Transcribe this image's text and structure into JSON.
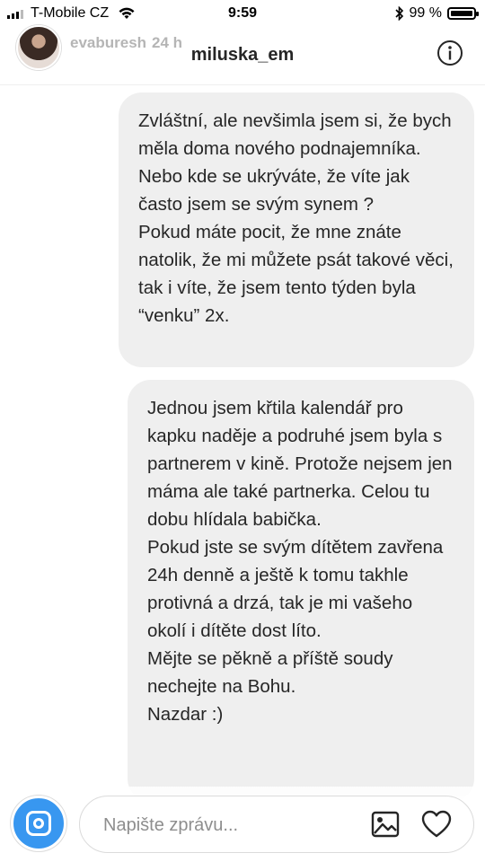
{
  "status_bar": {
    "carrier": "T-Mobile CZ",
    "time": "9:59",
    "battery_percent": "99 %",
    "battery_level": 0.99
  },
  "header": {
    "story_username": "evaburesh",
    "story_age": "24 h",
    "thread_title": "miluska_em",
    "info_icon": "info-icon"
  },
  "messages": [
    {
      "paragraphs": [
        "Zvláštní, ale nevšimla jsem si, že bych měla doma nového podnajemníka. Nebo kde se ukrýváte, že víte jak často jsem se svým synem ?",
        "Pokud máte pocit, že mne znáte natolik, že mi můžete psát takové věci, tak i víte, že jsem tento týden byla “venku” 2x."
      ]
    },
    {
      "paragraphs": [
        "Jednou jsem křtila kalendář pro kapku naděje a podruhé jsem byla s partnerem v kině. Protože nejsem jen máma ale také partnerka. Celou tu dobu hlídala babička.",
        "Pokud jste se svým dítětem zavřena 24h denně a ještě k tomu takhle protivná a drzá, tak je mi vašeho okolí i dítěte dost líto.",
        "Mějte se pěkně a příště soudy nechejte na Bohu.",
        "Nazdar :)"
      ]
    }
  ],
  "composer": {
    "placeholder": "Napište zprávu...",
    "value": "",
    "camera_icon": "camera-icon",
    "gallery_icon": "gallery-icon",
    "heart_icon": "heart-icon"
  }
}
